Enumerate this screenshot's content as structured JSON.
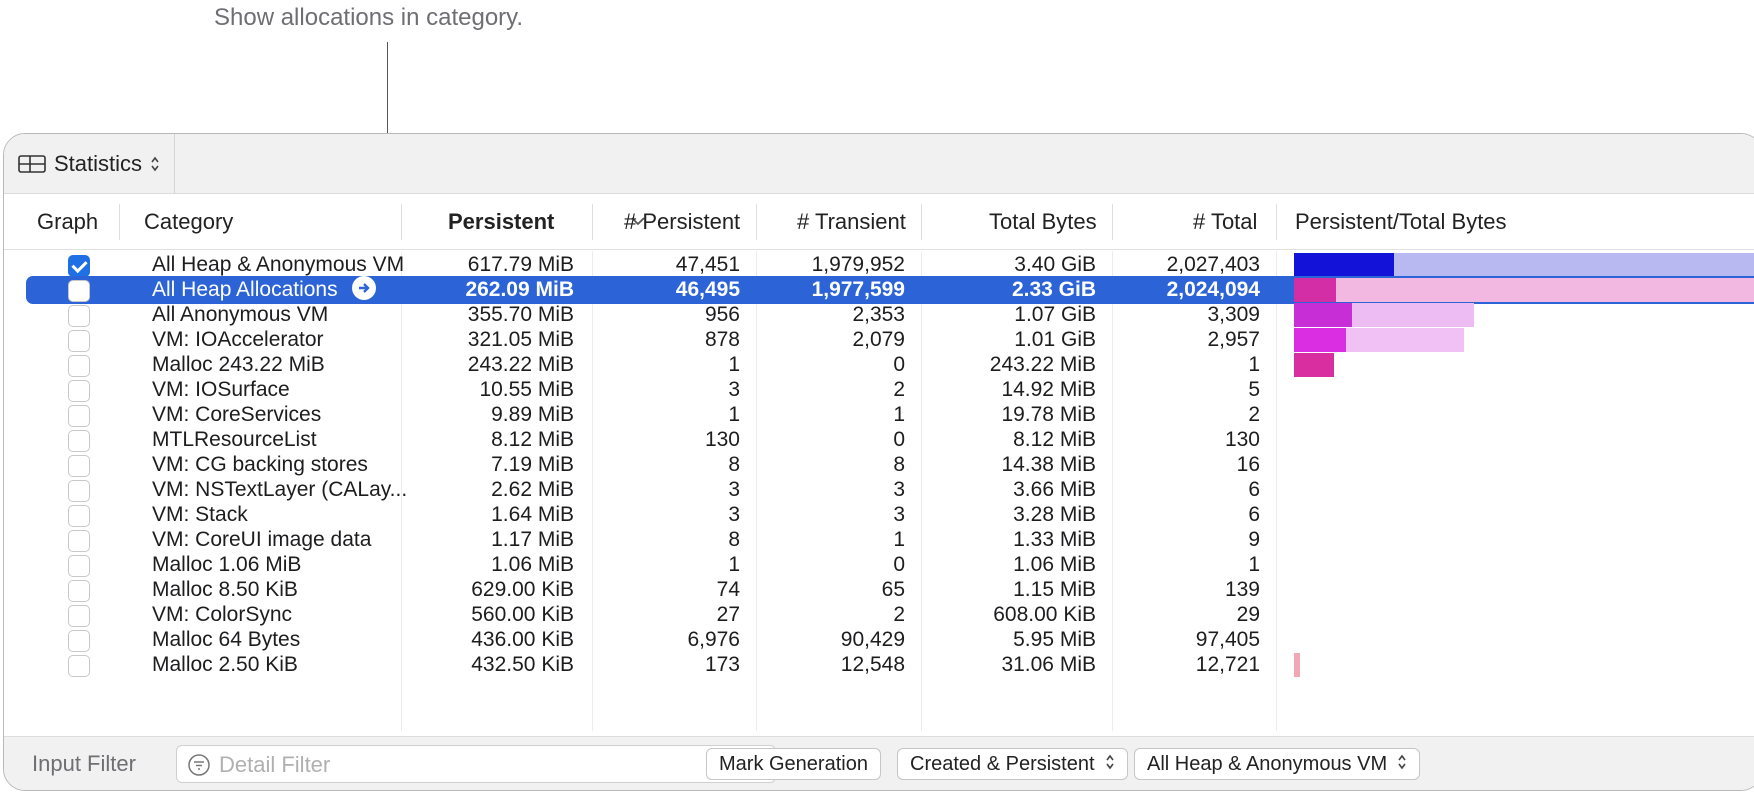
{
  "callout": "Show allocations in category.",
  "toolbar": {
    "view_label": "Statistics"
  },
  "columns": {
    "graph": "Graph",
    "category": "Category",
    "persistent": "Persistent",
    "num_persistent": "# Persistent",
    "num_transient": "# Transient",
    "total_bytes": "Total Bytes",
    "num_total": "# Total",
    "ratio": "Persistent/Total Bytes"
  },
  "rows": [
    {
      "graph": true,
      "category": "All Heap & Anonymous VM",
      "persistent": "617.79 MiB",
      "num_persistent": "47,451",
      "num_transient": "1,979,952",
      "total_bytes": "3.40 GiB",
      "num_total": "2,027,403",
      "ratio": 0.177,
      "bar_color": "#1212d8",
      "bar_light": "#b9b9f2",
      "bar_total": 1.0
    },
    {
      "graph": false,
      "category": "All Heap Allocations",
      "persistent": "262.09 MiB",
      "num_persistent": "46,495",
      "num_transient": "1,977,599",
      "total_bytes": "2.33 GiB",
      "num_total": "2,024,094",
      "ratio": 0.11,
      "bar_color": "#d42ea6",
      "bar_light": "#f2b8e2",
      "bar_total": 1.0
    },
    {
      "graph": false,
      "category": "All Anonymous VM",
      "persistent": "355.70 MiB",
      "num_persistent": "956",
      "num_transient": "2,353",
      "total_bytes": "1.07 GiB",
      "num_total": "3,309",
      "ratio": 0.324,
      "bar_color": "#c82ed6",
      "bar_light": "#ecbcf3",
      "bar_total": 1.0
    },
    {
      "graph": false,
      "category": "VM: IOAccelerator",
      "persistent": "321.05 MiB",
      "num_persistent": "878",
      "num_transient": "2,079",
      "total_bytes": "1.01 GiB",
      "num_total": "2,957",
      "ratio": 0.31,
      "bar_color": "#d92ee2",
      "bar_light": "#f1c1f5",
      "bar_total": 1.0
    },
    {
      "graph": false,
      "category": "Malloc 243.22 MiB",
      "persistent": "243.22 MiB",
      "num_persistent": "1",
      "num_transient": "0",
      "total_bytes": "243.22 MiB",
      "num_total": "1",
      "ratio": 1.0,
      "bar_color": "#d92ea0",
      "bar_light": "#d92ea0",
      "bar_total": 1.0
    },
    {
      "graph": false,
      "category": "VM: IOSurface",
      "persistent": "10.55 MiB",
      "num_persistent": "3",
      "num_transient": "2",
      "total_bytes": "14.92 MiB",
      "num_total": "5"
    },
    {
      "graph": false,
      "category": "VM: CoreServices",
      "persistent": "9.89 MiB",
      "num_persistent": "1",
      "num_transient": "1",
      "total_bytes": "19.78 MiB",
      "num_total": "2"
    },
    {
      "graph": false,
      "category": "MTLResourceList",
      "persistent": "8.12 MiB",
      "num_persistent": "130",
      "num_transient": "0",
      "total_bytes": "8.12 MiB",
      "num_total": "130"
    },
    {
      "graph": false,
      "category": "VM: CG backing stores",
      "persistent": "7.19 MiB",
      "num_persistent": "8",
      "num_transient": "8",
      "total_bytes": "14.38 MiB",
      "num_total": "16"
    },
    {
      "graph": false,
      "category": "VM: NSTextLayer (CALay...",
      "persistent": "2.62 MiB",
      "num_persistent": "3",
      "num_transient": "3",
      "total_bytes": "3.66 MiB",
      "num_total": "6"
    },
    {
      "graph": false,
      "category": "VM: Stack",
      "persistent": "1.64 MiB",
      "num_persistent": "3",
      "num_transient": "3",
      "total_bytes": "3.28 MiB",
      "num_total": "6"
    },
    {
      "graph": false,
      "category": "VM: CoreUI image data",
      "persistent": "1.17 MiB",
      "num_persistent": "8",
      "num_transient": "1",
      "total_bytes": "1.33 MiB",
      "num_total": "9"
    },
    {
      "graph": false,
      "category": "Malloc 1.06 MiB",
      "persistent": "1.06 MiB",
      "num_persistent": "1",
      "num_transient": "0",
      "total_bytes": "1.06 MiB",
      "num_total": "1"
    },
    {
      "graph": false,
      "category": "Malloc 8.50 KiB",
      "persistent": "629.00 KiB",
      "num_persistent": "74",
      "num_transient": "65",
      "total_bytes": "1.15 MiB",
      "num_total": "139"
    },
    {
      "graph": false,
      "category": "VM: ColorSync",
      "persistent": "560.00 KiB",
      "num_persistent": "27",
      "num_transient": "2",
      "total_bytes": "608.00 KiB",
      "num_total": "29"
    },
    {
      "graph": false,
      "category": "Malloc 64 Bytes",
      "persistent": "436.00 KiB",
      "num_persistent": "6,976",
      "num_transient": "90,429",
      "total_bytes": "5.95 MiB",
      "num_total": "97,405"
    },
    {
      "graph": false,
      "category": "Malloc 2.50 KiB",
      "persistent": "432.50 KiB",
      "num_persistent": "173",
      "num_transient": "12,548",
      "total_bytes": "31.06 MiB",
      "num_total": "12,721",
      "ratio": 0.014,
      "bar_color": "#f1a8b4",
      "bar_light": "#f1a8b4",
      "bar_total": 0.02
    }
  ],
  "selected_row": 1,
  "footer": {
    "input_filter_label": "Input Filter",
    "detail_filter_placeholder": "Detail Filter",
    "mark_generation": "Mark Generation",
    "allocation_lifespan": "Created & Persistent",
    "allocation_type": "All Heap & Anonymous VM"
  }
}
